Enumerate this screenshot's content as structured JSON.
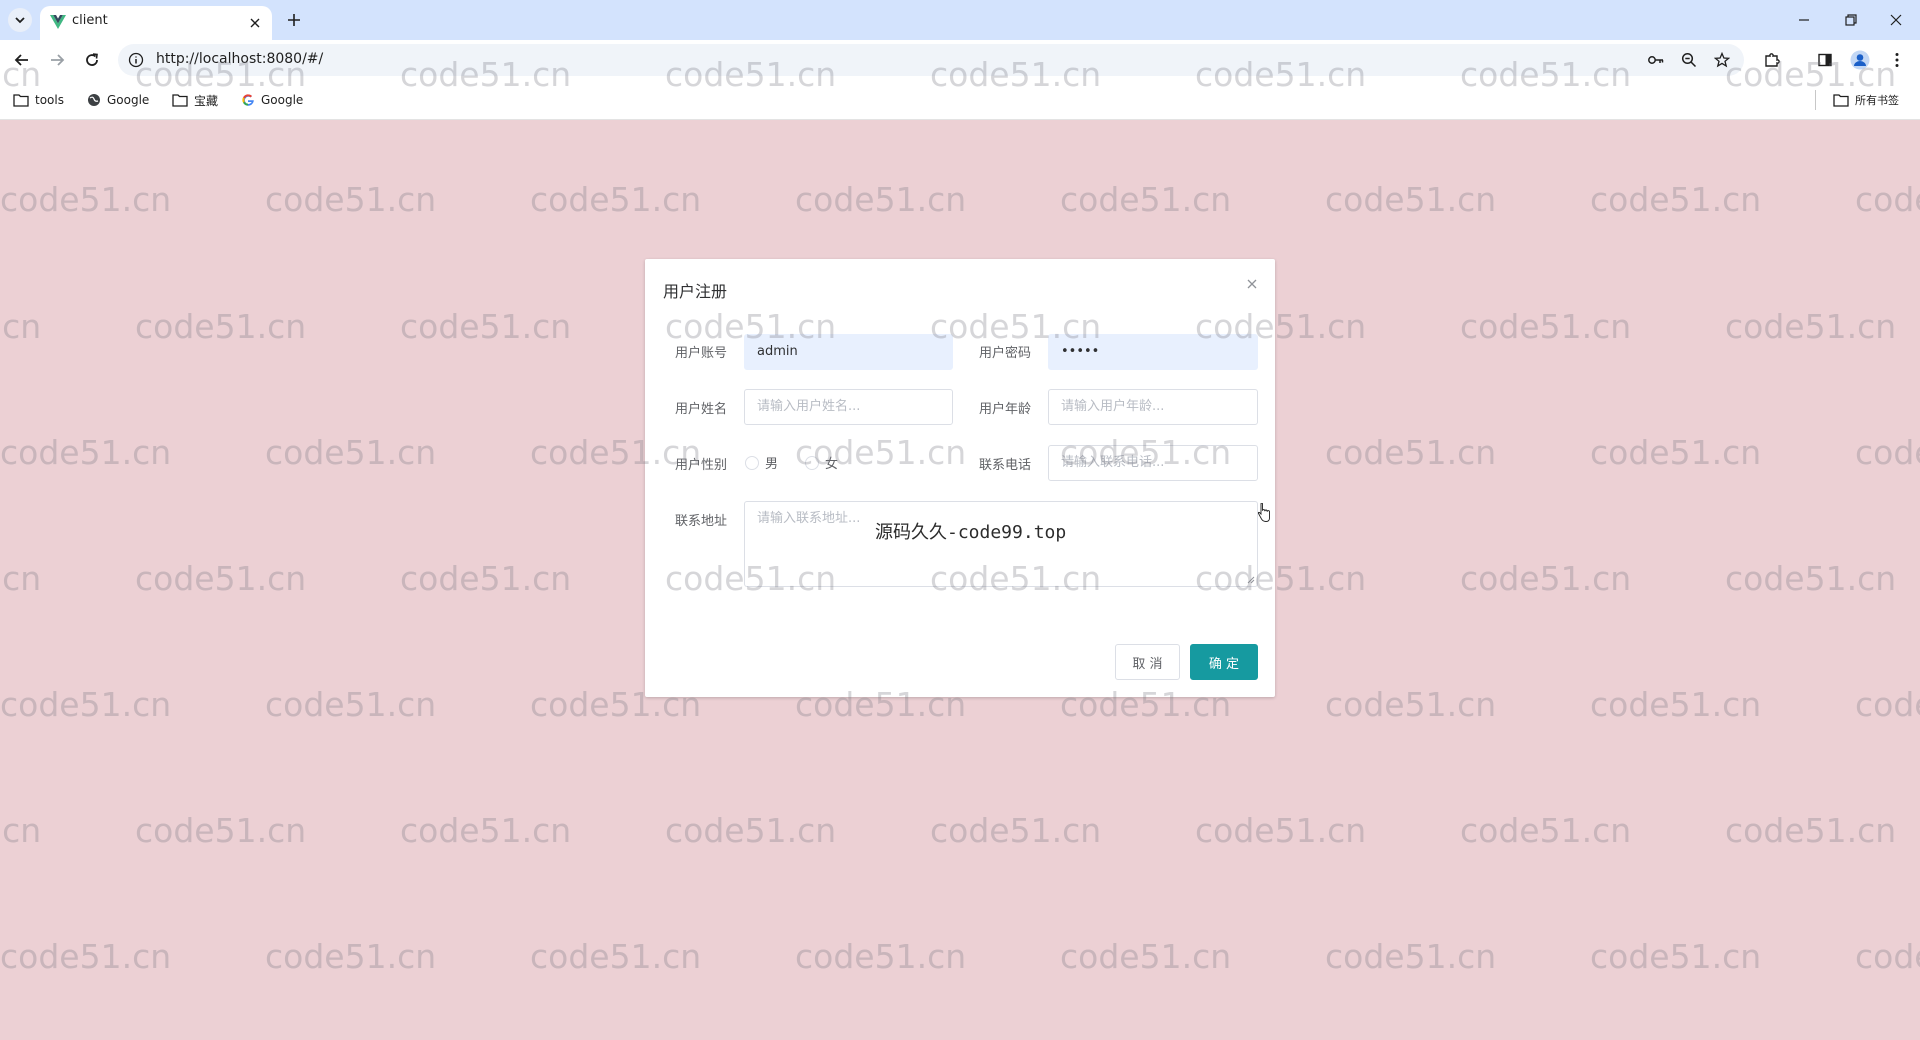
{
  "browser": {
    "tab_title": "client",
    "url": "http://localhost:8080/#/",
    "bookmarks": [
      "tools",
      "Google",
      "宝藏",
      "Google"
    ],
    "all_bookmarks_label": "所有书签"
  },
  "watermark_text": "code51.cn",
  "dialog": {
    "title": "用户注册",
    "fields": {
      "account_label": "用户账号",
      "account_value": "admin",
      "password_label": "用户密码",
      "password_value": "•••••",
      "name_label": "用户姓名",
      "name_placeholder": "请输入用户姓名...",
      "age_label": "用户年龄",
      "age_placeholder": "请输入用户年龄...",
      "gender_label": "用户性别",
      "gender_male": "男",
      "gender_female": "女",
      "phone_label": "联系电话",
      "phone_placeholder": "请输入联系电话...",
      "address_label": "联系地址",
      "address_placeholder": "请输入联系地址..."
    },
    "overlay_text": "源码久久-code99.top",
    "cancel_label": "取 消",
    "ok_label": "确 定"
  },
  "colors": {
    "primary": "#169aa0",
    "page_bg": "#ecd0d4",
    "tabbar_bg": "#d3e3fd"
  }
}
